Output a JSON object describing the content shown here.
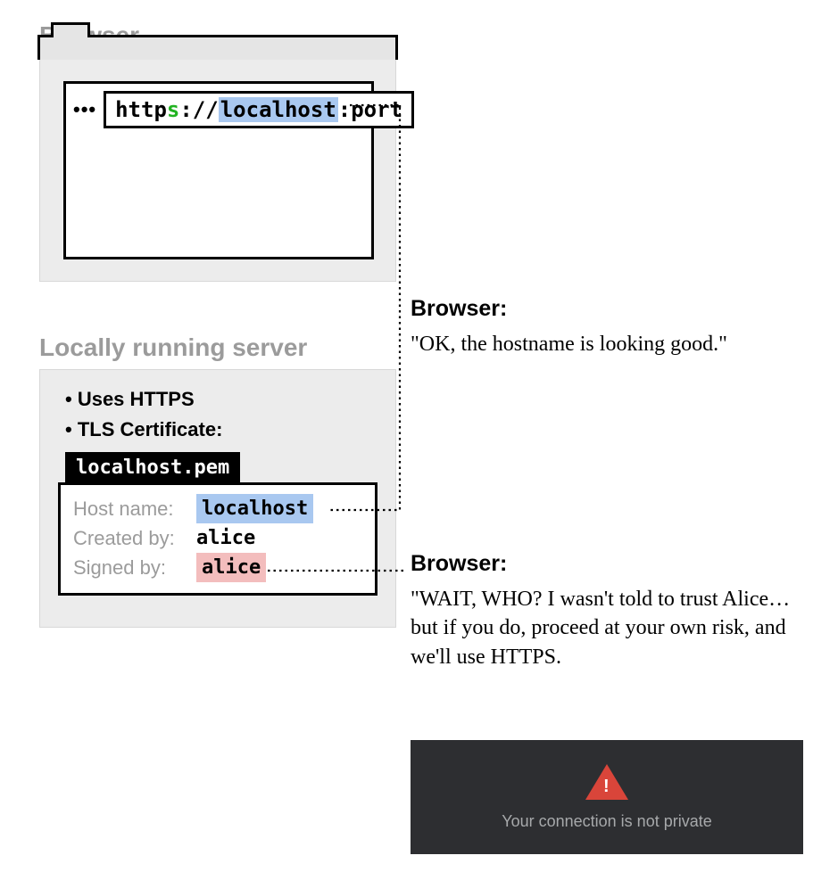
{
  "titles": {
    "browser": "Browser",
    "server": "Locally running server"
  },
  "address": {
    "dots": "•••",
    "http": "http",
    "s": "s",
    "sep": "://",
    "host": "localhost",
    "port": ":port"
  },
  "server": {
    "bullet1": "Uses HTTPS",
    "bullet2": "TLS Certificate:",
    "cert_filename": "localhost.pem",
    "rows": {
      "host_key": "Host name:",
      "host_val": "localhost",
      "created_key": "Created by:",
      "created_val": "alice",
      "signed_key": "Signed by:",
      "signed_val": "alice"
    }
  },
  "annotations": {
    "heading1": "Browser:",
    "quote1": "\"OK, the hostname is looking good.\"",
    "heading2": "Browser:",
    "quote2": "\"WAIT, WHO? I wasn't told to trust Alice… but if you do, proceed at your own risk, and we'll use HTTPS."
  },
  "warning": {
    "text": "Your connection is not private"
  }
}
